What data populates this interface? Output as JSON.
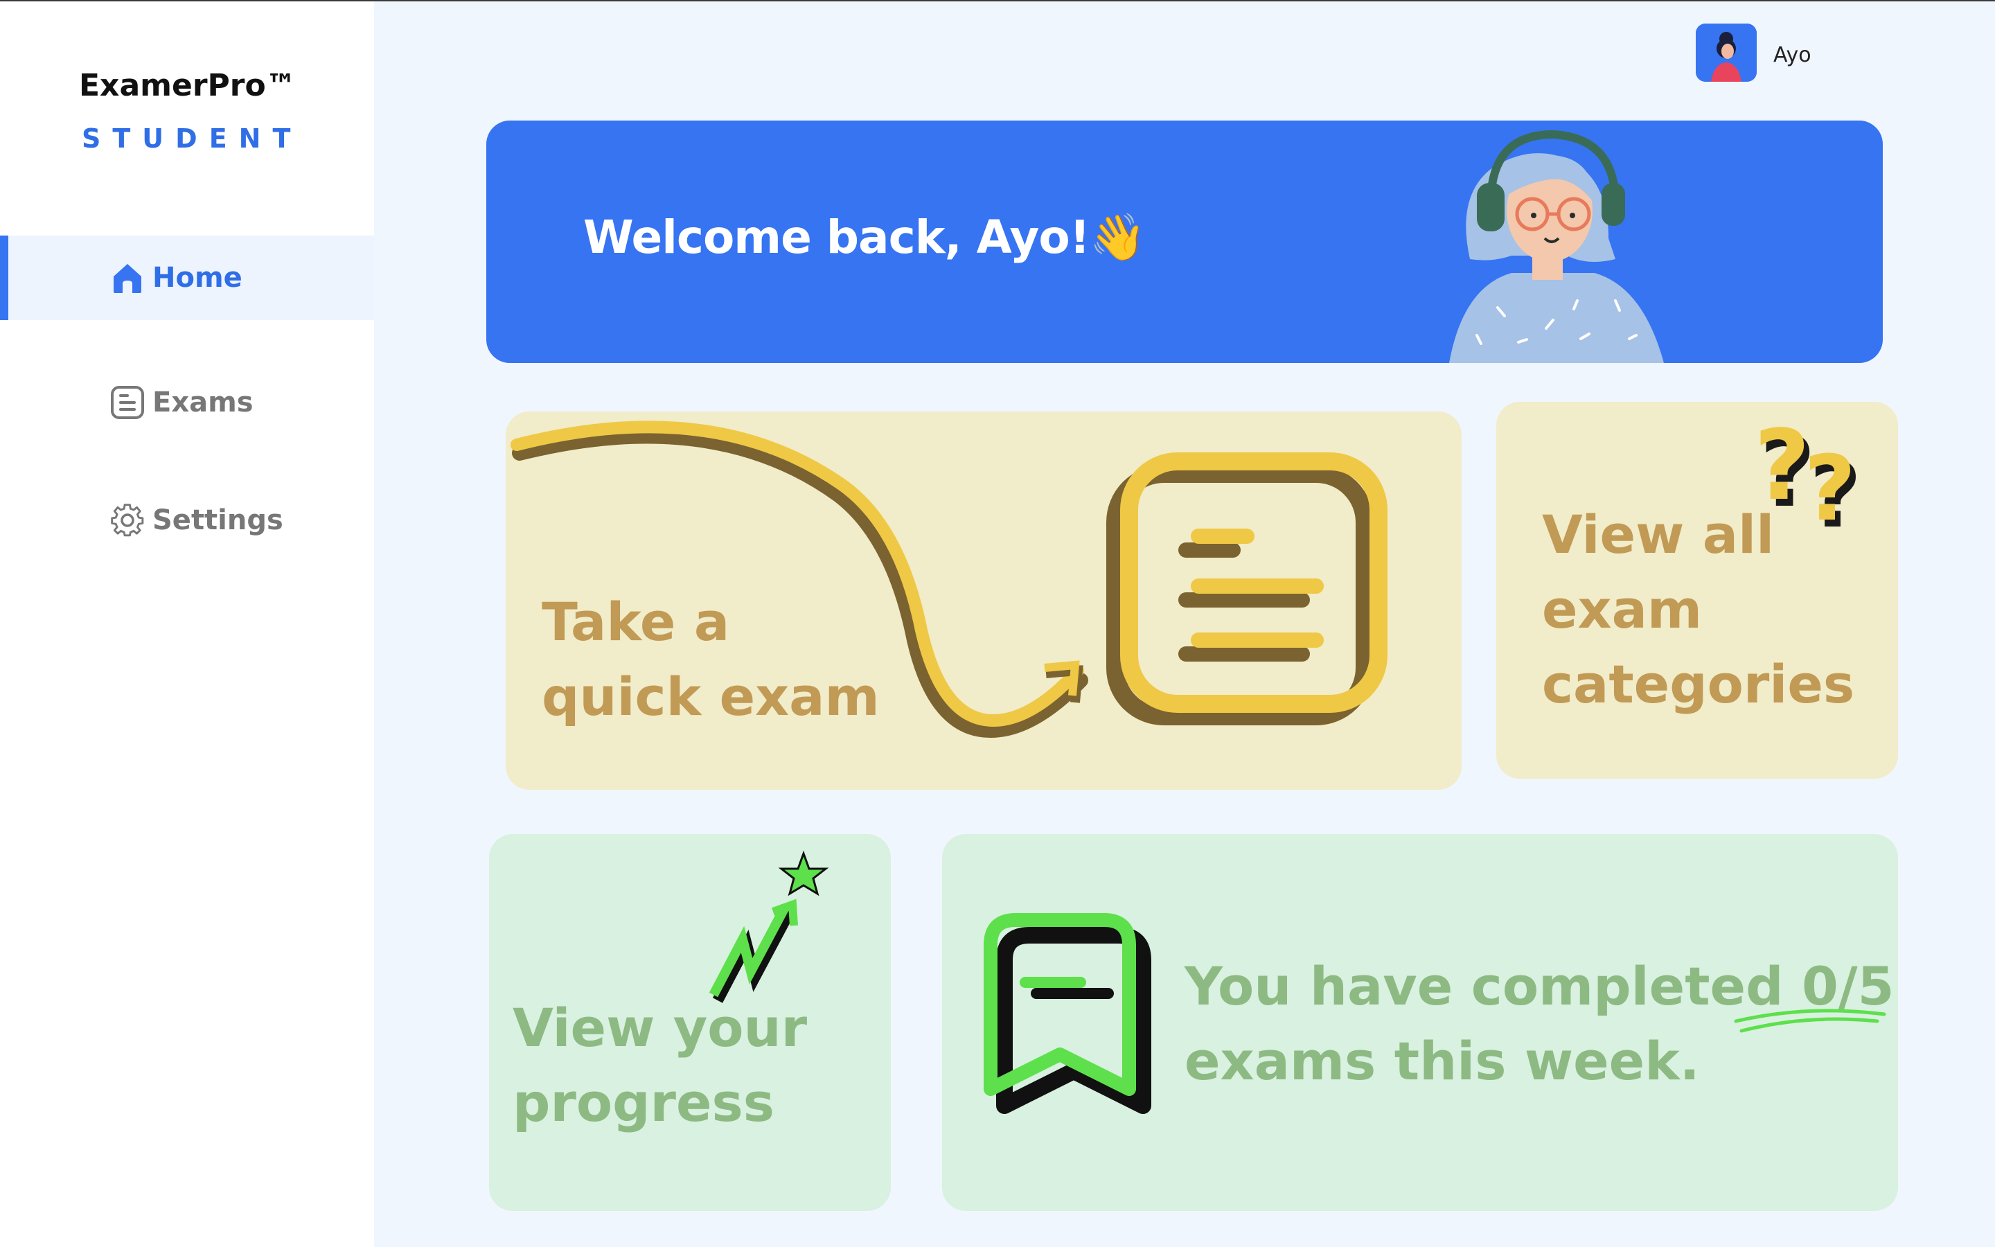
{
  "app": {
    "brand": "ExamerPro™",
    "role": "STUDENT"
  },
  "sidebar": {
    "items": [
      {
        "label": "Home",
        "icon": "home-icon",
        "active": true
      },
      {
        "label": "Exams",
        "icon": "document-icon",
        "active": false
      },
      {
        "label": "Settings",
        "icon": "gear-icon",
        "active": false
      }
    ]
  },
  "header": {
    "username": "Ayo"
  },
  "banner": {
    "greeting": "Welcome back, Ayo!👋"
  },
  "cards": {
    "quick_exam": {
      "line1": "Take a",
      "line2": "quick exam"
    },
    "categories": {
      "line1": "View all",
      "line2": "exam",
      "line3": "categories"
    },
    "progress": {
      "line1": "View your",
      "line2": "progress"
    },
    "weekly": {
      "line1_prefix": "You have completed ",
      "count": "0/5",
      "line2": "exams this week."
    }
  },
  "colors": {
    "accent": "#3674f2",
    "yellow_card": "#f1ecc9",
    "green_card": "#d9f1e0",
    "yellow_text": "#c19a55",
    "green_text": "#8dba83"
  }
}
